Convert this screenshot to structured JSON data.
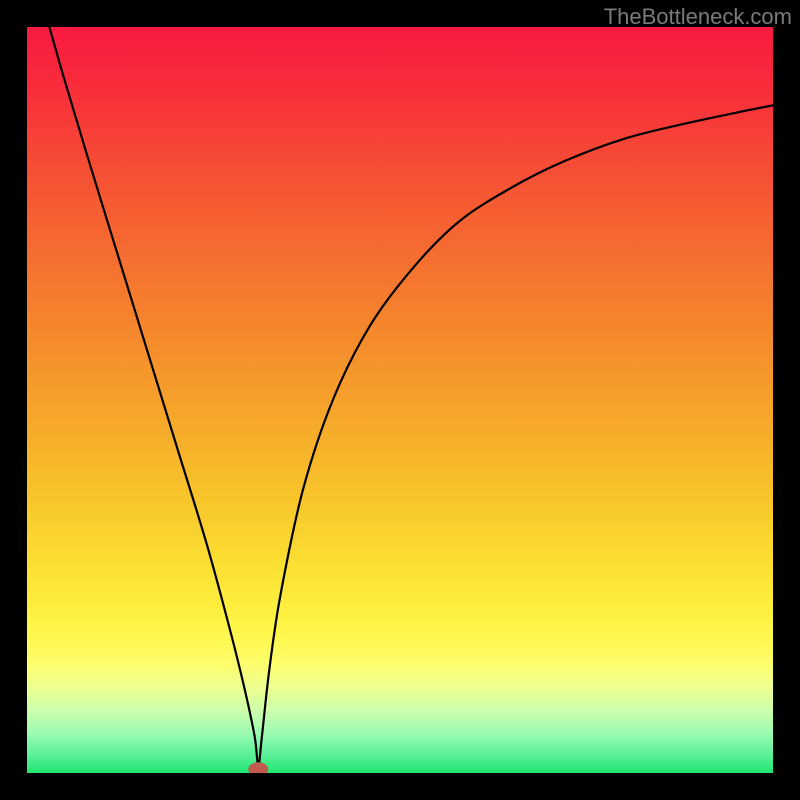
{
  "watermark": "TheBottleneck.com",
  "chart_data": {
    "type": "line",
    "title": "",
    "xlabel": "",
    "ylabel": "",
    "xlim": [
      0,
      100
    ],
    "ylim": [
      0,
      100
    ],
    "series": [
      {
        "name": "bottleneck-curve",
        "x": [
          3,
          5,
          8,
          12,
          16,
          20,
          24,
          27,
          29,
          30.5,
          31,
          31.5,
          32.5,
          34,
          37,
          41,
          46,
          52,
          58,
          65,
          72,
          80,
          88,
          95,
          100
        ],
        "y": [
          100,
          93,
          83,
          70,
          57,
          44,
          31,
          20,
          12,
          5,
          1,
          5,
          14,
          24,
          38,
          50,
          60,
          68,
          74,
          78.5,
          82,
          85,
          87,
          88.5,
          89.5
        ]
      }
    ],
    "marker": {
      "name": "optimal-point",
      "x": 31,
      "y": 0.5,
      "color": "#c15a4f"
    },
    "background_gradient": {
      "stops": [
        {
          "offset": 0.0,
          "color": "#f81a3f"
        },
        {
          "offset": 0.08,
          "color": "#f82c3b"
        },
        {
          "offset": 0.18,
          "color": "#f64b35"
        },
        {
          "offset": 0.3,
          "color": "#f56c30"
        },
        {
          "offset": 0.42,
          "color": "#f58b2c"
        },
        {
          "offset": 0.54,
          "color": "#f6ab2a"
        },
        {
          "offset": 0.64,
          "color": "#f8c72b"
        },
        {
          "offset": 0.72,
          "color": "#fbdf32"
        },
        {
          "offset": 0.78,
          "color": "#feef3f"
        },
        {
          "offset": 0.82,
          "color": "#fff850"
        },
        {
          "offset": 0.855,
          "color": "#fcfe6e"
        },
        {
          "offset": 0.885,
          "color": "#edff8f"
        },
        {
          "offset": 0.915,
          "color": "#cfffab"
        },
        {
          "offset": 0.945,
          "color": "#a0fbb2"
        },
        {
          "offset": 0.975,
          "color": "#5cf19a"
        },
        {
          "offset": 1.0,
          "color": "#1ee56f"
        }
      ]
    }
  }
}
